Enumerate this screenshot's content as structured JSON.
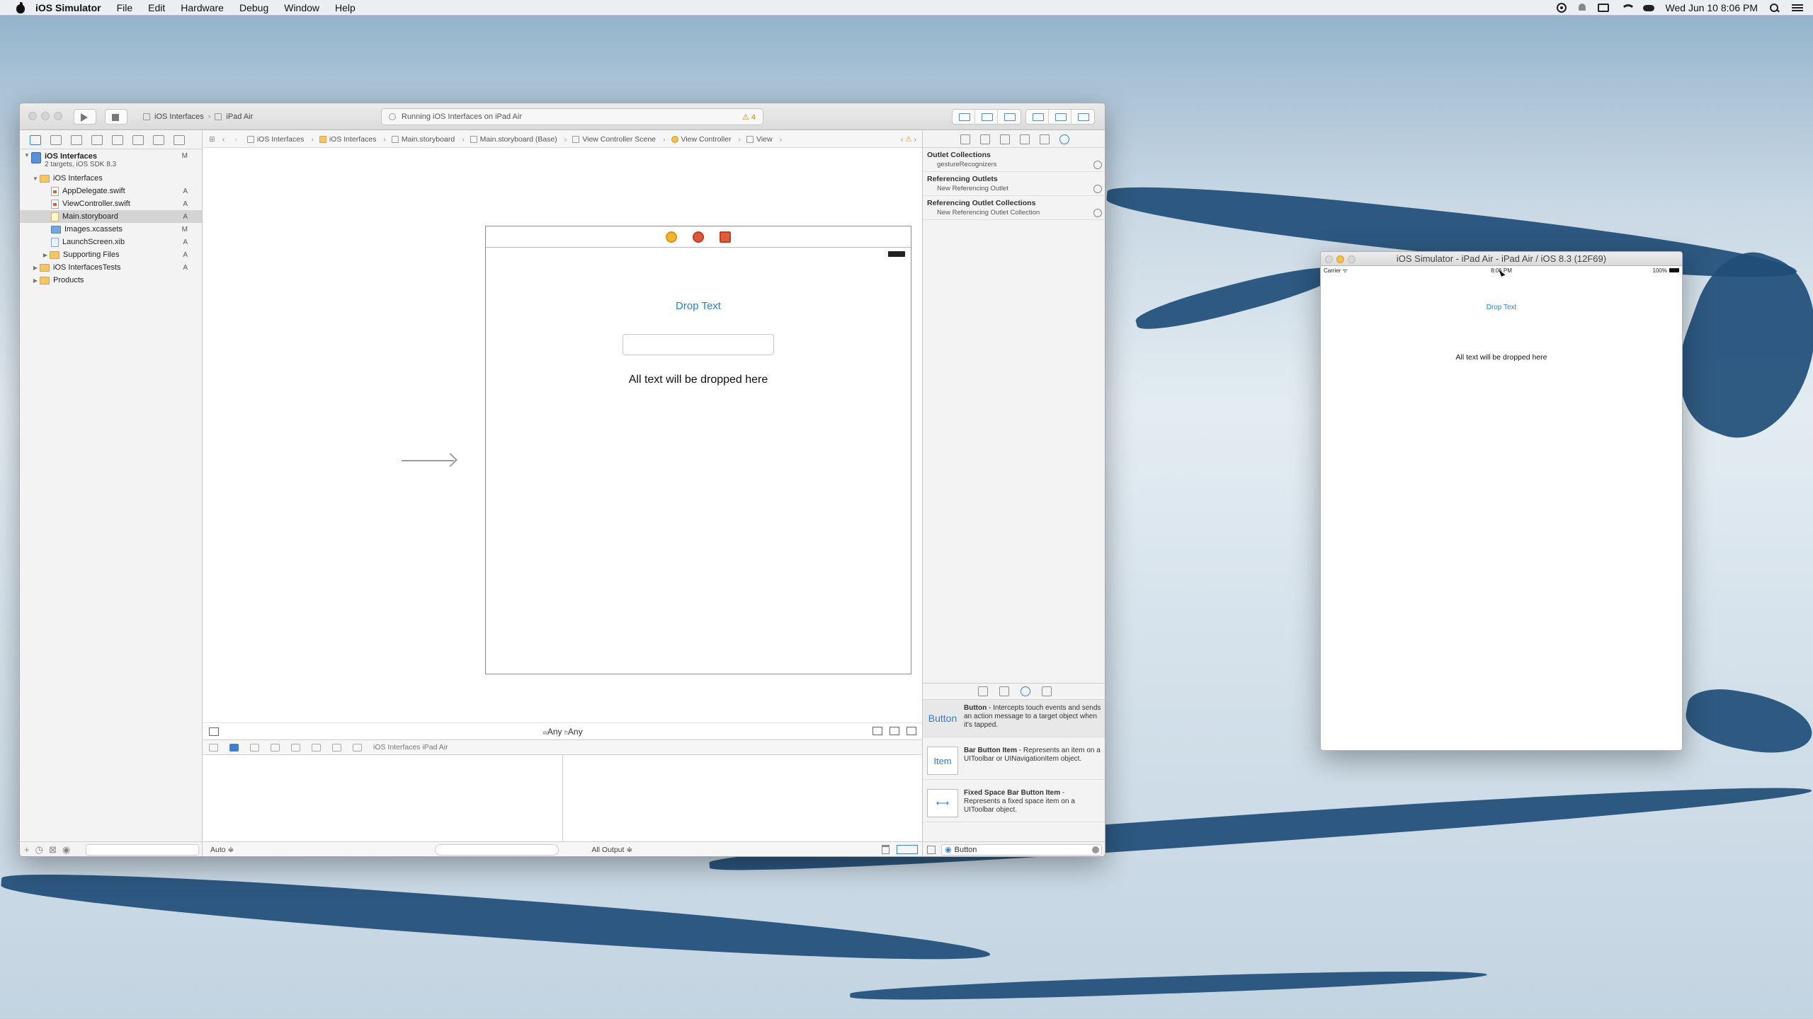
{
  "menubar": {
    "app_name": "iOS Simulator",
    "items": [
      "File",
      "Edit",
      "Hardware",
      "Debug",
      "Window",
      "Help"
    ],
    "clock": "Wed Jun 10  8:06 PM"
  },
  "xcode": {
    "scheme": "iOS Interfaces",
    "device": "iPad Air",
    "activity": "Running iOS Interfaces on iPad Air",
    "warnings": "4",
    "navigator": {
      "project_name": "iOS Interfaces",
      "project_sub": "2 targets, iOS SDK 8.3",
      "project_badge": "M",
      "rows": [
        {
          "label": "iOS Interfaces",
          "badge": ""
        },
        {
          "label": "AppDelegate.swift",
          "badge": "A"
        },
        {
          "label": "ViewController.swift",
          "badge": "A"
        },
        {
          "label": "Main.storyboard",
          "badge": "A"
        },
        {
          "label": "Images.xcassets",
          "badge": "M"
        },
        {
          "label": "LaunchScreen.xib",
          "badge": "A"
        },
        {
          "label": "Supporting Files",
          "badge": "A"
        },
        {
          "label": "iOS InterfacesTests",
          "badge": "A"
        },
        {
          "label": "Products",
          "badge": ""
        }
      ]
    },
    "jumpbar": [
      "iOS Interfaces",
      "iOS Interfaces",
      "Main.storyboard",
      "Main.storyboard (Base)",
      "View Controller Scene",
      "View Controller",
      "View"
    ],
    "canvas": {
      "button_title": "Drop Text",
      "label_text": "All text will be dropped here",
      "size_class": "wAny hAny",
      "size_w": "Any",
      "size_h": "Any"
    },
    "debugbar_target": "iOS Interfaces  iPad Air",
    "bottom": {
      "auto": "Auto ≑",
      "output": "All Output ≑"
    },
    "connections": {
      "outlet_collections": "Outlet Collections",
      "outlet_collections_item": "gestureRecognizers",
      "referencing_outlets": "Referencing Outlets",
      "referencing_outlets_item": "New Referencing Outlet",
      "referencing_outlet_collections": "Referencing Outlet Collections",
      "referencing_outlet_collections_item": "New Referencing Outlet Collection"
    },
    "library": [
      {
        "icon": "Button",
        "title": "Button",
        "desc": " - Intercepts touch events and sends an action message to a target object when it's tapped."
      },
      {
        "icon": "Item",
        "title": "Bar Button Item",
        "desc": " - Represents an item on a UIToolbar or UINavigationItem object."
      },
      {
        "icon": "⟷",
        "title": "Fixed Space Bar Button Item",
        "desc": " - Represents a fixed space item on a UIToolbar object."
      }
    ],
    "library_filter": "Button"
  },
  "simulator": {
    "title": "iOS Simulator - iPad Air - iPad Air / iOS 8.3 (12F69)",
    "carrier": "Carrier ᯤ",
    "time": "8:06 PM",
    "battery": "100%",
    "button_title": "Drop Text",
    "label_text": "All text will be dropped here"
  }
}
